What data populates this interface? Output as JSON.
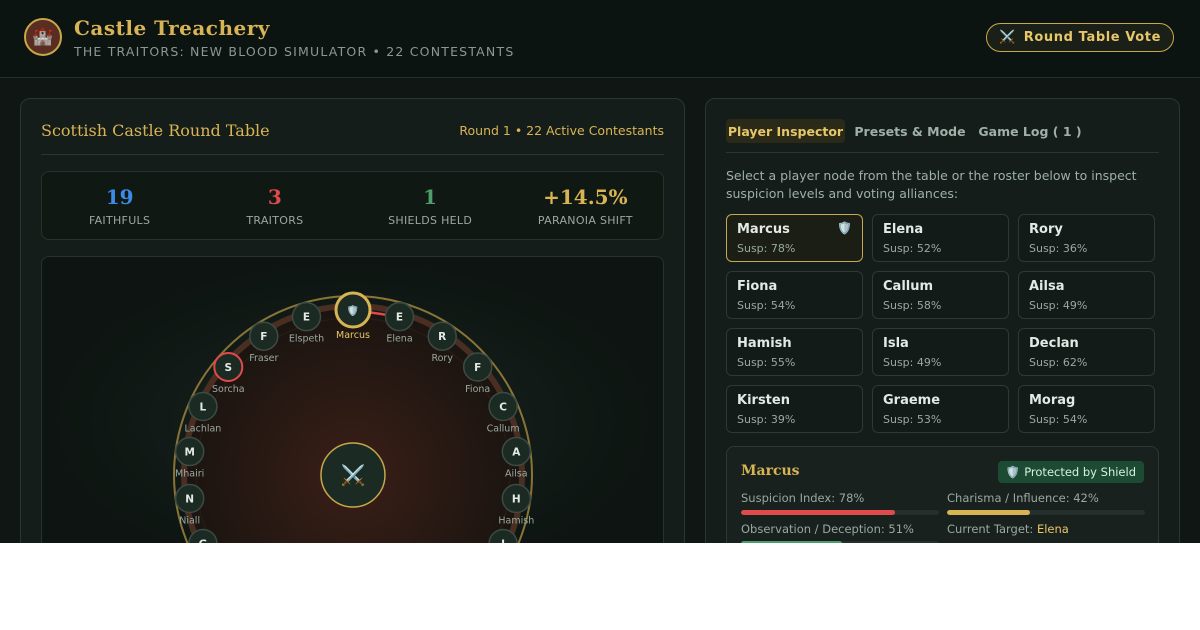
{
  "header": {
    "logo_icon": "castle-icon",
    "title": "Castle Treachery",
    "subtitle": "THE TRAITORS: NEW BLOOD SIMULATOR • 22 CONTESTANTS",
    "vote_button_icon": "crossed-swords-icon",
    "vote_button_label": "Round Table Vote"
  },
  "left_panel": {
    "title": "Scottish Castle Round Table",
    "round_info": "Round 1 • 22 Active Contestants",
    "stats": [
      {
        "value": "19",
        "label": "FAITHFULS",
        "color": "#3d8be8"
      },
      {
        "value": "3",
        "label": "TRAITORS",
        "color": "#e04a4a"
      },
      {
        "value": "1",
        "label": "SHIELDS HELD",
        "color": "#4f9d6d"
      },
      {
        "value": "+14.5%",
        "label": "PARANOIA SHIFT",
        "color": "#d9b454"
      }
    ],
    "table": {
      "center_icon": "crossed-swords-icon",
      "seats": [
        {
          "initial": "",
          "name": "Marcus",
          "shield": true,
          "selected": true
        },
        {
          "initial": "E",
          "name": "Elena"
        },
        {
          "initial": "R",
          "name": "Rory"
        },
        {
          "initial": "F",
          "name": "Fiona"
        },
        {
          "initial": "C",
          "name": "Callum"
        },
        {
          "initial": "A",
          "name": "Ailsa"
        },
        {
          "initial": "H",
          "name": "Hamish"
        },
        {
          "initial": "I",
          "name": ""
        },
        {
          "initial": "",
          "name": ""
        },
        {
          "initial": "",
          "name": ""
        },
        {
          "initial": "",
          "name": ""
        },
        {
          "initial": "",
          "name": ""
        },
        {
          "initial": "",
          "name": ""
        },
        {
          "initial": "",
          "name": ""
        },
        {
          "initial": "",
          "name": ""
        },
        {
          "initial": "G",
          "name": ""
        },
        {
          "initial": "N",
          "name": "Niall"
        },
        {
          "initial": "M",
          "name": "Mhairi"
        },
        {
          "initial": "L",
          "name": "Lachlan"
        },
        {
          "initial": "S",
          "name": "Sorcha",
          "traitor": true
        },
        {
          "initial": "F",
          "name": "Fraser"
        },
        {
          "initial": "E",
          "name": "Elspeth"
        }
      ]
    }
  },
  "right_panel": {
    "tabs": [
      {
        "label": "Player Inspector",
        "active": true
      },
      {
        "label": "Presets & Mode",
        "active": false
      },
      {
        "label": "Game Log ( 1 )",
        "active": false
      }
    ],
    "description": "Select a player node from the table or the roster below to inspect suspicion levels and voting alliances:",
    "roster": [
      {
        "name": "Marcus",
        "susp": "Susp: 78%",
        "shield": true,
        "selected": true
      },
      {
        "name": "Elena",
        "susp": "Susp: 52%"
      },
      {
        "name": "Rory",
        "susp": "Susp: 36%"
      },
      {
        "name": "Fiona",
        "susp": "Susp: 54%"
      },
      {
        "name": "Callum",
        "susp": "Susp: 58%"
      },
      {
        "name": "Ailsa",
        "susp": "Susp: 49%"
      },
      {
        "name": "Hamish",
        "susp": "Susp: 55%"
      },
      {
        "name": "Isla",
        "susp": "Susp: 49%"
      },
      {
        "name": "Declan",
        "susp": "Susp: 62%"
      },
      {
        "name": "Kirsten",
        "susp": "Susp: 39%"
      },
      {
        "name": "Graeme",
        "susp": "Susp: 53%"
      },
      {
        "name": "Morag",
        "susp": "Susp: 54%"
      }
    ],
    "detail": {
      "name": "Marcus",
      "badge_icon": "shield-icon",
      "badge": "Protected by Shield",
      "metrics": [
        {
          "label": "Suspicion Index: 78%",
          "value": 0.78,
          "color": "#e04a4a"
        },
        {
          "label": "Charisma / Influence: 42%",
          "value": 0.42,
          "color": "#d9b454"
        },
        {
          "label": "Observation / Deception: 51%",
          "value": 0.51,
          "color": "#4f9d6d"
        }
      ],
      "target_label": "Current Target:",
      "target_value": "Elena"
    }
  }
}
